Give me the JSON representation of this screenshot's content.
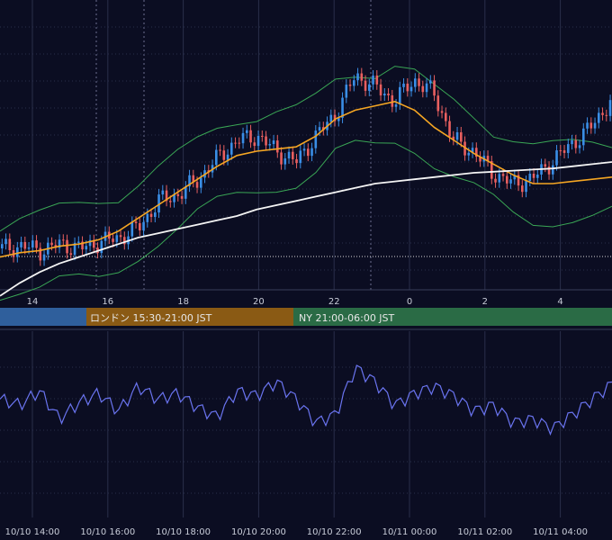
{
  "colors": {
    "background": "#0b0d22",
    "grid": "#2a2f4a",
    "candle_up": "#3a8ee6",
    "candle_down": "#e85f5f",
    "ma_short": "#f5a623",
    "ma_long": "#f4f4f4",
    "bollinger": "#3aa655",
    "oscillator": "#6a74f0",
    "session_tokyo": "#2f5f9c",
    "session_london": "#8a5a14",
    "session_ny": "#2a6b45",
    "axis_text": "#c8ccd8"
  },
  "sessions": [
    {
      "name": "tokyo",
      "label": ""
    },
    {
      "name": "london",
      "label": "ロンドン 15:30-21:00 JST"
    },
    {
      "name": "ny",
      "label": "NY 21:00-06:00 JST"
    }
  ],
  "chart_data": [
    {
      "type": "candlestick",
      "title": "",
      "x_tick_labels": [
        "14",
        "16",
        "18",
        "20",
        "22",
        "0",
        "2",
        "4"
      ],
      "grid": true,
      "series": [
        {
          "kind": "candles",
          "close": [
            0.1,
            0.11,
            0.09,
            0.12,
            0.1,
            0.13,
            0.15,
            0.2,
            0.32,
            0.35,
            0.42,
            0.52,
            0.6,
            0.62,
            0.55,
            0.5,
            0.62,
            0.72,
            0.9,
            0.85,
            0.78,
            0.88,
            0.82,
            0.6,
            0.55,
            0.45,
            0.4,
            0.42,
            0.5,
            0.58,
            0.66,
            0.78
          ]
        },
        {
          "kind": "moving-average-short",
          "values": [
            0.06,
            0.08,
            0.09,
            0.11,
            0.12,
            0.14,
            0.18,
            0.24,
            0.3,
            0.36,
            0.42,
            0.48,
            0.53,
            0.55,
            0.56,
            0.57,
            0.62,
            0.7,
            0.74,
            0.76,
            0.78,
            0.74,
            0.66,
            0.6,
            0.54,
            0.49,
            0.44,
            0.4,
            0.4,
            0.41,
            0.42,
            0.43
          ]
        },
        {
          "kind": "moving-average-long",
          "values": [
            -0.12,
            -0.06,
            -0.01,
            0.03,
            0.06,
            0.09,
            0.12,
            0.15,
            0.17,
            0.19,
            0.21,
            0.23,
            0.25,
            0.28,
            0.3,
            0.32,
            0.34,
            0.36,
            0.38,
            0.4,
            0.41,
            0.42,
            0.43,
            0.44,
            0.45,
            0.455,
            0.46,
            0.465,
            0.47,
            0.48,
            0.49,
            0.5
          ]
        },
        {
          "kind": "bollinger-band",
          "values": []
        }
      ]
    },
    {
      "type": "line",
      "title": "",
      "x_tick_labels": [
        "10/10 14:00",
        "10/10 16:00",
        "10/10 18:00",
        "10/10 20:00",
        "10/10 22:00",
        "10/11 00:00",
        "10/11 02:00",
        "10/11 04:00"
      ],
      "grid": true,
      "series": [
        {
          "kind": "oscillator",
          "values": [
            0.55,
            0.5,
            0.62,
            0.38,
            0.52,
            0.6,
            0.45,
            0.66,
            0.55,
            0.6,
            0.48,
            0.4,
            0.62,
            0.58,
            0.7,
            0.55,
            0.35,
            0.42,
            0.82,
            0.7,
            0.5,
            0.6,
            0.66,
            0.58,
            0.45,
            0.5,
            0.35,
            0.38,
            0.3,
            0.42,
            0.55,
            0.68
          ]
        }
      ]
    }
  ]
}
